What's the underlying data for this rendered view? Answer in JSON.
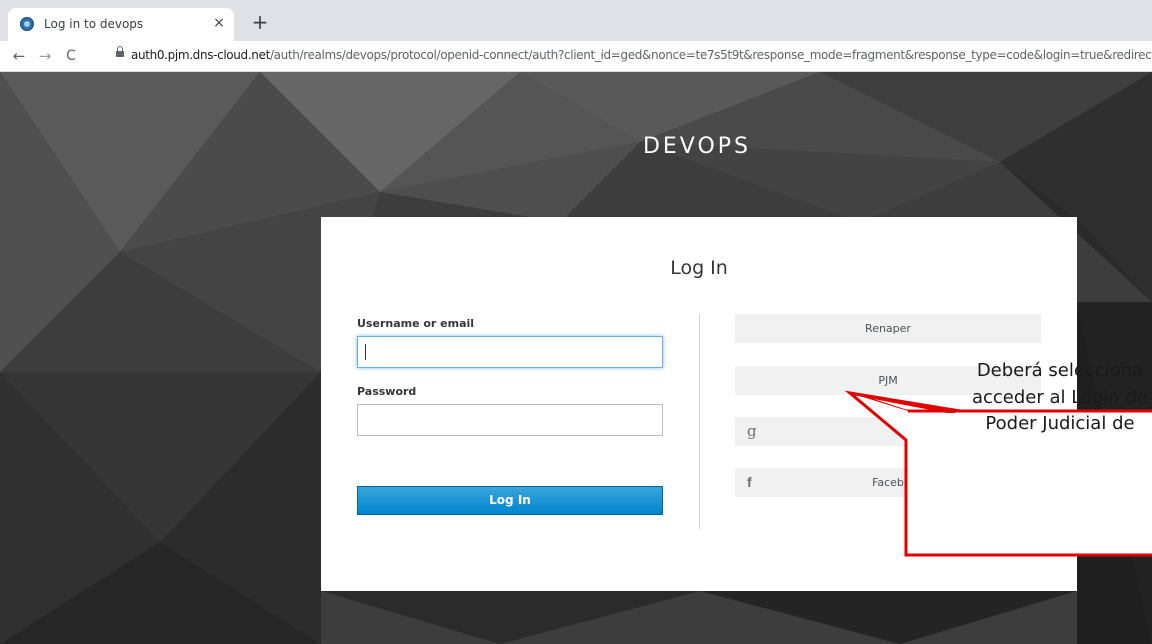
{
  "browser": {
    "tab_title": "Log in to devops",
    "tab_close": "×",
    "new_tab": "+",
    "back": "←",
    "forward": "→",
    "reload": "C",
    "url_host": "auth0.pjm.dns-cloud.net",
    "url_path": "/auth/realms/devops/protocol/openid-connect/auth?client_id=ged&nonce=te7s5t9t&response_mode=fragment&response_type=code&login=true&redirect_"
  },
  "page": {
    "realm_name": "DEVOPS",
    "title": "Log In",
    "username_label": "Username or email",
    "password_label": "Password",
    "login_button": "Log In",
    "providers": [
      {
        "label": "Renaper",
        "icon": ""
      },
      {
        "label": "PJM",
        "icon": ""
      },
      {
        "label": "",
        "icon": "g"
      },
      {
        "label": "Faceb",
        "icon": "f"
      }
    ]
  },
  "callout": {
    "lines": [
      "Deberá selecciona",
      "acceder al Login de",
      "Poder Judicial de"
    ],
    "border_color": "#e00000"
  }
}
